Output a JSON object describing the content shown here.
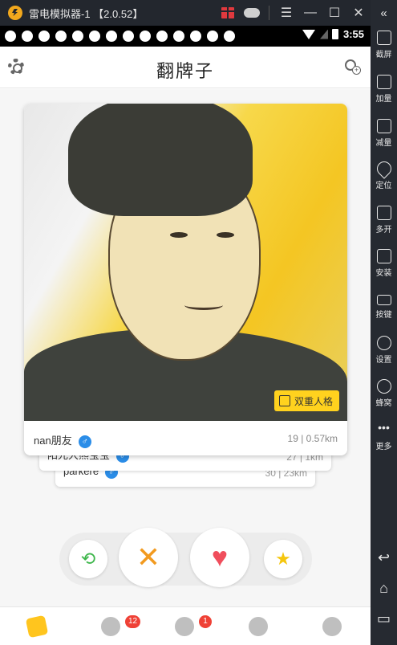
{
  "emulator": {
    "title": "雷电模拟器-1 【2.0.52】",
    "title_buttons": [
      "gift-icon",
      "gamepad-icon",
      "menu-icon",
      "minimize-icon",
      "maximize-icon",
      "close-icon"
    ],
    "sidebar": {
      "collapse": "«",
      "items": [
        {
          "label": "截屏",
          "icon": "scissors-icon"
        },
        {
          "label": "加量",
          "icon": "volume-up-icon"
        },
        {
          "label": "减量",
          "icon": "volume-down-icon"
        },
        {
          "label": "定位",
          "icon": "location-icon"
        },
        {
          "label": "多开",
          "icon": "multi-open-icon"
        },
        {
          "label": "安装",
          "icon": "apk-install-icon"
        },
        {
          "label": "按键",
          "icon": "keyboard-icon"
        },
        {
          "label": "设置",
          "icon": "settings-icon"
        },
        {
          "label": "蜂窝",
          "icon": "hive-icon"
        },
        {
          "label": "更多",
          "icon": "more-icon"
        }
      ],
      "nav": [
        "back-icon",
        "home-icon",
        "recents-icon"
      ]
    }
  },
  "statusbar": {
    "time": "3:55",
    "notification_count": 14
  },
  "app": {
    "title": "翻牌子",
    "cards": {
      "front": {
        "name": "nan朋友",
        "gender": "♂",
        "meta": "19 | 0.57km",
        "tag": "双重人格"
      },
      "back": [
        {
          "name": "阳光大熊宝宝",
          "gender": "♂",
          "meta": "27 | 1km"
        },
        {
          "name": "parkere",
          "gender": "♂",
          "meta": "30 | 23km"
        }
      ]
    },
    "actions": {
      "undo": "⟲",
      "nope": "✕",
      "like": "♥",
      "super_like": "★"
    },
    "bottom_nav": [
      {
        "name": "cards",
        "badge": ""
      },
      {
        "name": "messages",
        "badge": "12"
      },
      {
        "name": "friends",
        "badge": "1"
      },
      {
        "name": "moments",
        "badge": ""
      },
      {
        "name": "profile",
        "badge": ""
      }
    ]
  }
}
